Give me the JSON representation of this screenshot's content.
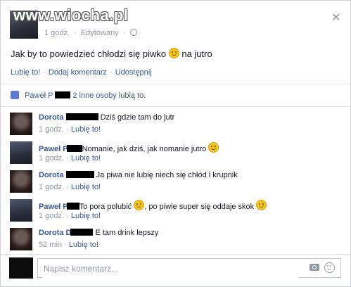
{
  "watermark": "www.wiocha.pl",
  "post": {
    "time": "1 godz.",
    "edited": "Edytowany",
    "dot": "·",
    "text_before": "Jak by to powiedzieć chłodzi się piwko",
    "text_after": "na jutro",
    "actions": {
      "like": "Lubię to!",
      "comment": "Dodaj komentarz",
      "share": "Udostępnij"
    }
  },
  "likes": {
    "name_visible": "Paweł P",
    "rest_visible": "2 inne osoby",
    "suffix": "lubią to."
  },
  "comments": [
    {
      "author": "Dorota",
      "text": "Dziś gdzie tam do jutr",
      "time": "1 godz.",
      "like": "Lubię to!",
      "avatar": "female"
    },
    {
      "author": "Paweł P",
      "text": "Nomanie, jak dziś, jak nomanie jutro",
      "time": "1 godz.",
      "like": "Lubię to!",
      "avatar": "male"
    },
    {
      "author": "Dorota",
      "text": "Ja piwa nie lubię niech się chłód i krupnik",
      "time": "1 godz.",
      "like": "Lubię to!",
      "avatar": "female"
    },
    {
      "author": "Paweł P",
      "text_before": "To pora polubić",
      "text_after": ", po piwie super się oddaje skok",
      "time": "1 godz.",
      "like": "Lubię to!",
      "avatar": "male"
    },
    {
      "author": "Dorota D",
      "text": "E tam drink lepszy",
      "time": "52 min",
      "like": "Lubię to!",
      "avatar": "female"
    }
  ],
  "composer": {
    "placeholder": "Napisz komentarz..."
  },
  "colors": {
    "link": "#3b5998",
    "text": "#141823",
    "muted": "#9197a3"
  }
}
